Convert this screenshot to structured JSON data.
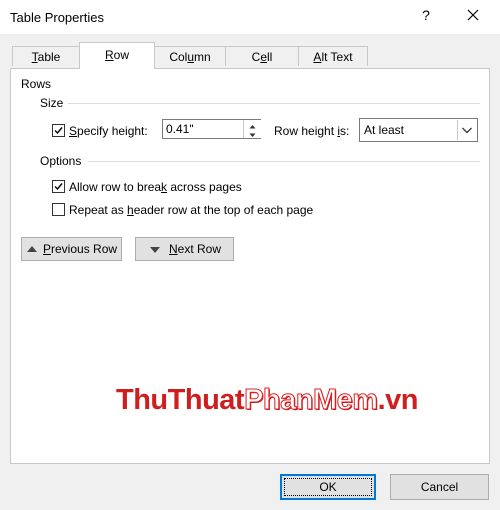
{
  "window": {
    "title": "Table Properties",
    "help_label": "?"
  },
  "tabs": [
    {
      "pre": "",
      "u": "T",
      "post": "able"
    },
    {
      "pre": "",
      "u": "R",
      "post": "ow"
    },
    {
      "pre": "Col",
      "u": "u",
      "post": "mn"
    },
    {
      "pre": "C",
      "u": "e",
      "post": "ll"
    },
    {
      "pre": "",
      "u": "A",
      "post": "lt Text"
    }
  ],
  "rows_section": {
    "group_label": "Rows",
    "size_label": "Size",
    "specify_height": {
      "pre": "",
      "u": "S",
      "post": "pecify height:",
      "checked": true
    },
    "height_value": "0.41\"",
    "row_height_is": {
      "pre": "Row height ",
      "u": "i",
      "post": "s:"
    },
    "row_height_mode": "At least",
    "options_label": "Options",
    "allow_break": {
      "pre": "Allow row to brea",
      "u": "k",
      "post": " across pages",
      "checked": true
    },
    "repeat_header": {
      "pre": "Repeat as ",
      "u": "h",
      "post": "eader row at the top of each page",
      "checked": false
    }
  },
  "nav": {
    "previous": {
      "pre": "",
      "u": "P",
      "post": "revious Row"
    },
    "next": {
      "pre": "",
      "u": "N",
      "post": "ext Row"
    }
  },
  "watermark": {
    "part1": "ThuThuat",
    "part2": "PhanMem",
    "part3": ".vn"
  },
  "buttons": {
    "ok": "OK",
    "cancel": "Cancel"
  },
  "colors": {
    "focus_blue": "#0078d7",
    "watermark_red": "#d01e1e"
  }
}
